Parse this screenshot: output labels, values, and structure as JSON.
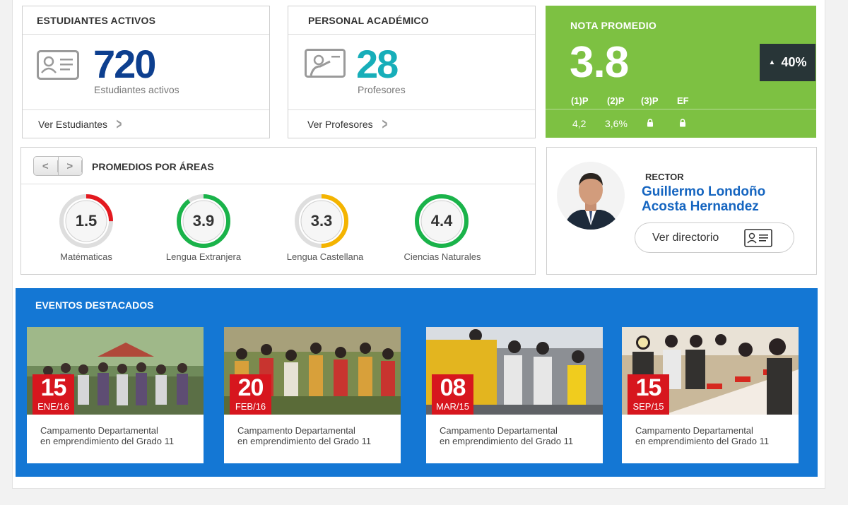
{
  "estudiantes": {
    "title": "ESTUDIANTES ACTIVOS",
    "count": "720",
    "subtitle": "Estudiantes activos",
    "link": "Ver Estudiantes",
    "color": "#0d3f8f"
  },
  "personal": {
    "title": "PERSONAL ACADÉMICO",
    "count": "28",
    "subtitle": "Profesores",
    "link": "Ver Profesores",
    "color": "#17aeb9"
  },
  "nota": {
    "title": "NOTA PROMEDIO",
    "value": "3.8",
    "change": "40%",
    "change_icon": "triangle-up-icon",
    "periods": [
      {
        "label": "(1)P",
        "value": "4,2",
        "locked": false
      },
      {
        "label": "(2)P",
        "value": "3,6%",
        "locked": false
      },
      {
        "label": "(3)P",
        "value": "",
        "locked": true
      },
      {
        "label": "EF",
        "value": "",
        "locked": true
      }
    ],
    "color": "#7dc142"
  },
  "promedios": {
    "title": "PROMEDIOS POR ÁREAS",
    "areas": [
      {
        "label": "Matématicas",
        "value": "1.5",
        "fraction": 0.25,
        "color": "#e3191f"
      },
      {
        "label": "Lengua Extranjera",
        "value": "3.9",
        "fraction": 0.9,
        "color": "#1ab34a"
      },
      {
        "label": "Lengua Castellana",
        "value": "3.3",
        "fraction": 0.5,
        "color": "#f4b400"
      },
      {
        "label": "Ciencias Naturales",
        "value": "4.4",
        "fraction": 1.0,
        "color": "#1ab34a"
      }
    ]
  },
  "rector": {
    "role": "RECTOR",
    "name_line1": "Guillermo Londoño",
    "name_line2": "Acosta Hernandez",
    "button": "Ver directorio"
  },
  "eventos": {
    "title": "EVENTOS DESTACADOS",
    "items": [
      {
        "day": "15",
        "month": "ENE/16",
        "line1": "Campamento Departamental",
        "line2": "en emprendimiento del Grado 11"
      },
      {
        "day": "20",
        "month": "FEB/16",
        "line1": "Campamento Departamental",
        "line2": "en emprendimiento del Grado 11"
      },
      {
        "day": "08",
        "month": "MAR/15",
        "line1": "Campamento Departamental",
        "line2": "en emprendimiento del Grado 11"
      },
      {
        "day": "15",
        "month": "SEP/15",
        "line1": "Campamento Departamental",
        "line2": "en emprendimiento del Grado 11"
      }
    ]
  }
}
